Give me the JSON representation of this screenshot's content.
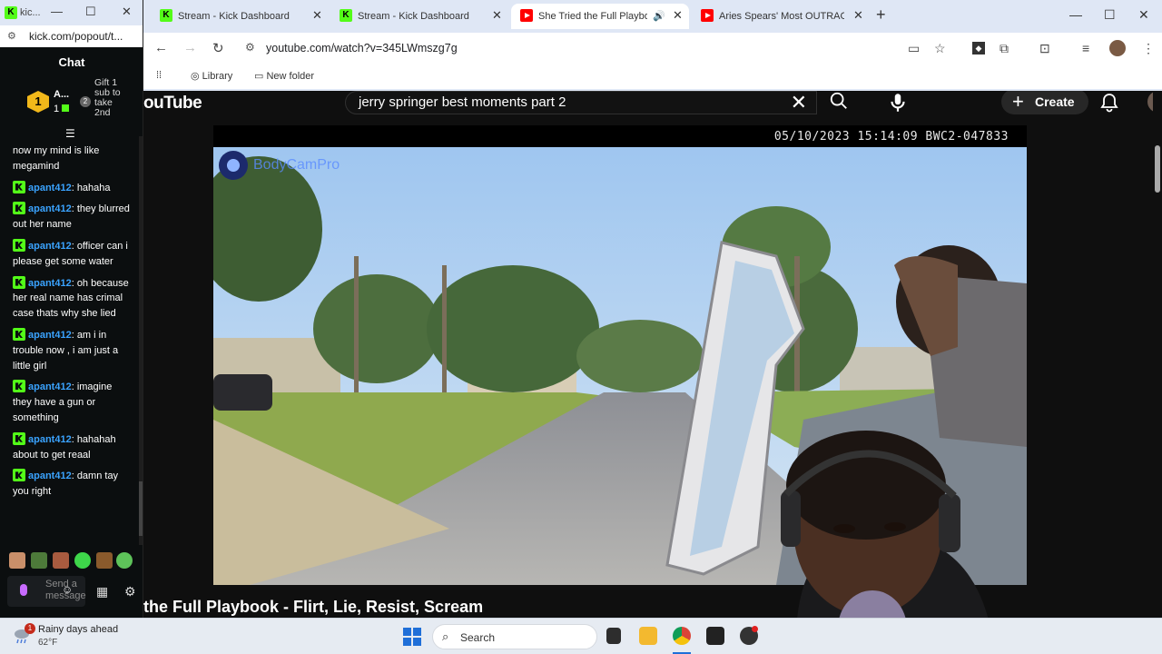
{
  "chat_window": {
    "title": "kic...",
    "min": "—",
    "max": "☐",
    "close": "✕",
    "url": "kick.com/popout/t...",
    "header": "Chat",
    "gift": {
      "rank": "1",
      "username": "A...",
      "count": "1",
      "text": "Gift 1 sub to take 2nd"
    },
    "messages": [
      {
        "user": "",
        "text": "now my mind is like megamind"
      },
      {
        "user": "apant412",
        "text": ": hahaha"
      },
      {
        "user": "apant412",
        "text": ": they blurred out her name"
      },
      {
        "user": "apant412",
        "text": ": officer can i please get some water"
      },
      {
        "user": "apant412",
        "text": ": oh because her real name has crimal case thats why she lied"
      },
      {
        "user": "apant412",
        "text": ": am i in trouble now , i am just a little girl"
      },
      {
        "user": "apant412",
        "text": ": imagine they have a gun or something"
      },
      {
        "user": "apant412",
        "text": ": hahahah about to get reaal"
      },
      {
        "user": "apant412",
        "text": ": damn tay you right"
      }
    ],
    "input_placeholder": "Send a message"
  },
  "browser": {
    "tabs": [
      {
        "label": "Stream - Kick Dashboard",
        "favicon": "kick-icon",
        "active": false
      },
      {
        "label": "Stream - Kick Dashboard",
        "favicon": "kick-icon",
        "active": false
      },
      {
        "label": "She Tried the Full Playbook",
        "favicon": "youtube-icon",
        "active": true
      },
      {
        "label": "Aries Spears' Most OUTRAGEOU",
        "favicon": "youtube-icon",
        "active": false
      }
    ],
    "new_tab": "+",
    "url": "youtube.com/watch?v=345LWmszg7g",
    "bookmarks": [
      {
        "label": "Library"
      },
      {
        "label": "New folder"
      }
    ]
  },
  "youtube": {
    "logo": "ouTube",
    "search_query": "jerry springer best moments part 2",
    "create_label": "Create",
    "video": {
      "timestamp": "05/10/2023 15:14:09 BWC2-047833",
      "watermark": "BodyCamPro",
      "title": "the Full Playbook - Flirt, Lie, Resist, Scream"
    }
  },
  "taskbar": {
    "weather_title": "Rainy days ahead",
    "weather_temp": "62°F",
    "weather_badge": "1",
    "search_label": "Search"
  },
  "colors": {
    "kick_green": "#53fc18",
    "chat_username": "#3aa3ff",
    "youtube_red": "#ff0000",
    "chrome_frame": "#dfe7f5"
  }
}
